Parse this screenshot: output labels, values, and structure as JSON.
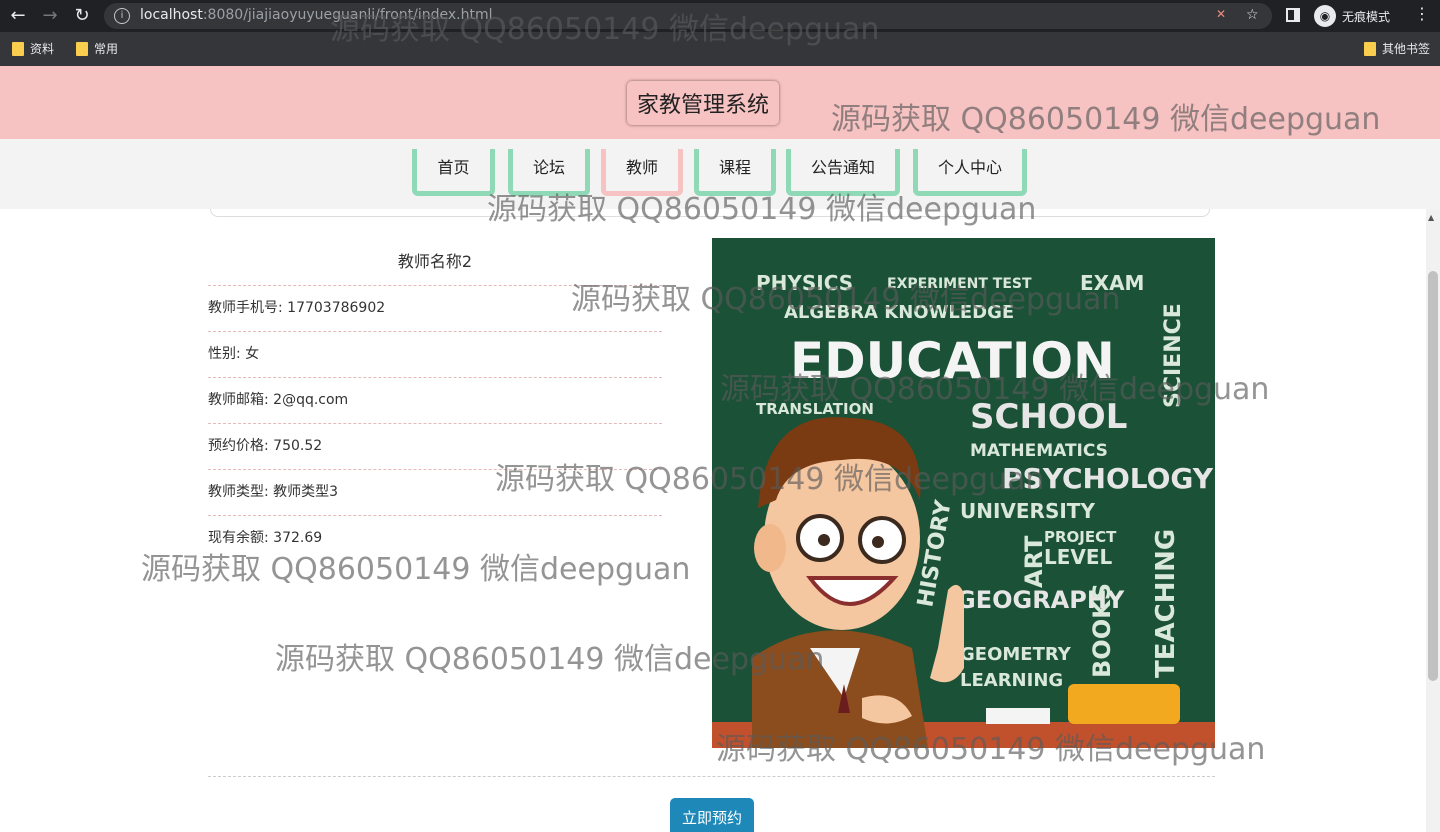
{
  "browser": {
    "url_host": "localhost",
    "url_path": ":8080/jiajiaoyuyueguanli/front/index.html",
    "incognito_label": "无痕模式",
    "bookmarks": [
      "资料",
      "常用"
    ],
    "other_bookmarks": "其他书签"
  },
  "site": {
    "title": "家教管理系统",
    "menu": [
      "首页",
      "论坛",
      "教师",
      "课程",
      "公告通知",
      "个人中心"
    ],
    "active_menu": "教师"
  },
  "teacher": {
    "name": "教师名称2",
    "phone": "教师手机号: 17703786902",
    "gender": "性别: 女",
    "email": "教师邮箱: 2@qq.com",
    "price": "预约价格: 750.52",
    "type": "教师类型: 教师类型3",
    "balance": "现有余额: 372.69"
  },
  "image_text": {
    "education": "EDUCATION",
    "physics": "PHYSICS",
    "experiment": "EXPERIMENT TEST",
    "exam": "EXAM",
    "algebra": "ALGEBRA KNOWLEDGE",
    "school": "SCHOOL",
    "translation": "TRANSLATION",
    "mathematics": "MATHEMATICS",
    "psychology": "PSYCHOLOGY",
    "university": "UNIVERSITY",
    "project": "PROJECT",
    "level": "LEVEL",
    "geography": "GEOGRAPHY",
    "books": "BOOKS",
    "teaching": "TEACHING",
    "science": "SCIENCE",
    "learning": "LEARNING",
    "geometry": "GEOMETRY",
    "art": "ART",
    "history": "HISTORY"
  },
  "actions": {
    "book_now": "立即预约"
  },
  "watermark": "源码获取 QQ86050149 微信deepguan"
}
